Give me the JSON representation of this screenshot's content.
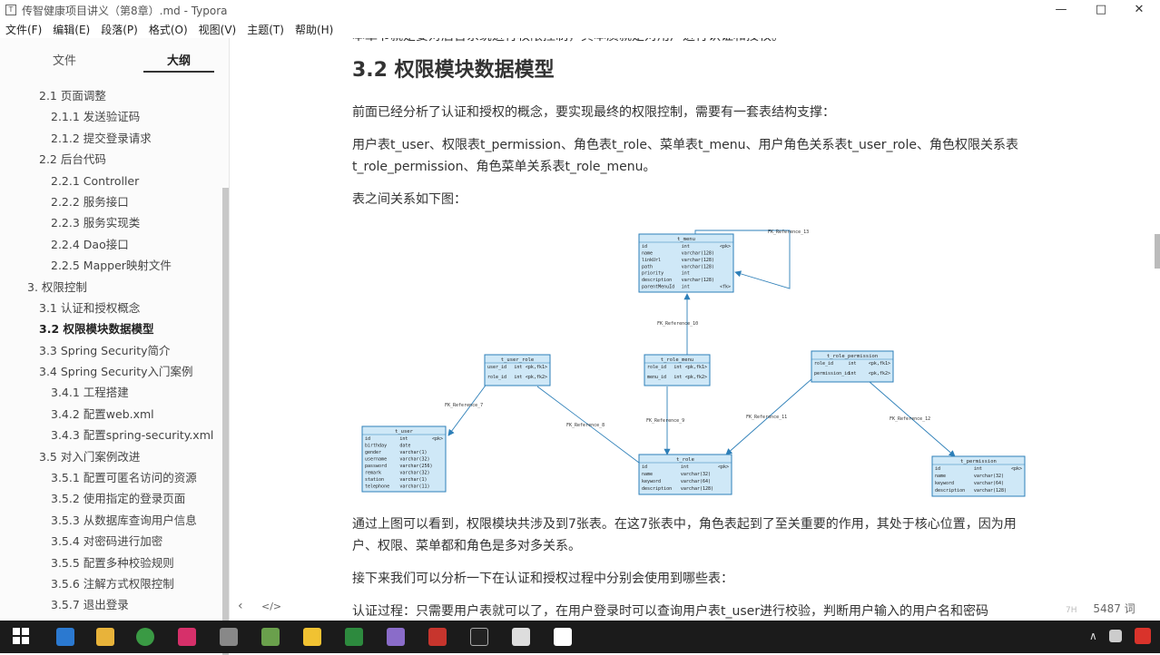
{
  "window": {
    "title": "传智健康项目讲义（第8章）.md - Typora",
    "minimize": "—",
    "maximize": "□",
    "close": "✕"
  },
  "menu": [
    "文件(F)",
    "编辑(E)",
    "段落(P)",
    "格式(O)",
    "视图(V)",
    "主题(T)",
    "帮助(H)"
  ],
  "sidebar": {
    "tabs": [
      "文件",
      "大纲"
    ],
    "outline": [
      {
        "label": "2.1 页面调整",
        "level": 2
      },
      {
        "label": "2.1.1 发送验证码",
        "level": 3
      },
      {
        "label": "2.1.2 提交登录请求",
        "level": 3
      },
      {
        "label": "2.2 后台代码",
        "level": 2
      },
      {
        "label": "2.2.1 Controller",
        "level": 3
      },
      {
        "label": "2.2.2 服务接口",
        "level": 3
      },
      {
        "label": "2.2.3 服务实现类",
        "level": 3
      },
      {
        "label": "2.2.4 Dao接口",
        "level": 3
      },
      {
        "label": "2.2.5 Mapper映射文件",
        "level": 3
      },
      {
        "label": "3. 权限控制",
        "level": 1
      },
      {
        "label": "3.1 认证和授权概念",
        "level": 2
      },
      {
        "label": "3.2 权限模块数据模型",
        "level": 2,
        "current": true
      },
      {
        "label": "3.3 Spring Security简介",
        "level": 2
      },
      {
        "label": "3.4 Spring Security入门案例",
        "level": 2
      },
      {
        "label": "3.4.1 工程搭建",
        "level": 3
      },
      {
        "label": "3.4.2 配置web.xml",
        "level": 3
      },
      {
        "label": "3.4.3 配置spring-security.xml",
        "level": 3
      },
      {
        "label": "3.5 对入门案例改进",
        "level": 2
      },
      {
        "label": "3.5.1 配置可匿名访问的资源",
        "level": 3
      },
      {
        "label": "3.5.2 使用指定的登录页面",
        "level": 3
      },
      {
        "label": "3.5.3 从数据库查询用户信息",
        "level": 3
      },
      {
        "label": "3.5.4 对密码进行加密",
        "level": 3
      },
      {
        "label": "3.5.5 配置多种校验规则",
        "level": 3
      },
      {
        "label": "3.5.6 注解方式权限控制",
        "level": 3
      },
      {
        "label": "3.5.7 退出登录",
        "level": 3
      }
    ],
    "footer_back": "‹",
    "footer_source": "</>"
  },
  "doc": {
    "cut_line": "本章节就是要对后台系统进行权限控制，其本质就是对用户进行认证和授权。",
    "heading": "3.2 权限模块数据模型",
    "p1": "前面已经分析了认证和授权的概念，要实现最终的权限控制，需要有一套表结构支撑：",
    "p2": "用户表t_user、权限表t_permission、角色表t_role、菜单表t_menu、用户角色关系表t_user_role、角色权限关系表t_role_permission、角色菜单关系表t_role_menu。",
    "p3": "表之间关系如下图：",
    "p4": "通过上图可以看到，权限模块共涉及到7张表。在这7张表中，角色表起到了至关重要的作用，其处于核心位置，因为用户、权限、菜单都和角色是多对多关系。",
    "p5": "接下来我们可以分析一下在认证和授权过程中分别会使用到哪些表：",
    "p6": "认证过程：只需要用户表就可以了，在用户登录时可以查询用户表t_user进行校验，判断用户输入的用户名和密码"
  },
  "diagram": {
    "tables": {
      "t_menu": {
        "title": "t_menu",
        "rows": [
          [
            "id",
            "int",
            "<pk>"
          ],
          [
            "name",
            "varchar(128)",
            ""
          ],
          [
            "linkUrl",
            "varchar(128)",
            ""
          ],
          [
            "path",
            "varchar(128)",
            ""
          ],
          [
            "priority",
            "int",
            ""
          ],
          [
            "description",
            "varchar(128)",
            ""
          ],
          [
            "parentMenuId",
            "int",
            "<fk>"
          ]
        ]
      },
      "t_user_role": {
        "title": "t_user_role",
        "rows": [
          [
            "user_id",
            "int",
            "<pk,fk1>"
          ],
          [
            "role_id",
            "int",
            "<pk,fk2>"
          ]
        ]
      },
      "t_role_menu": {
        "title": "t_role_menu",
        "rows": [
          [
            "role_id",
            "int",
            "<pk,fk1>"
          ],
          [
            "menu_id",
            "int",
            "<pk,fk2>"
          ]
        ]
      },
      "t_role_permission": {
        "title": "t_role_permission",
        "rows": [
          [
            "role_id",
            "int",
            "<pk,fk1>"
          ],
          [
            "permission_id",
            "int",
            "<pk,fk2>"
          ]
        ]
      },
      "t_user": {
        "title": "t_user",
        "rows": [
          [
            "id",
            "int",
            "<pk>"
          ],
          [
            "birthday",
            "date",
            ""
          ],
          [
            "gender",
            "varchar(1)",
            ""
          ],
          [
            "username",
            "varchar(32)",
            ""
          ],
          [
            "password",
            "varchar(256)",
            ""
          ],
          [
            "remark",
            "varchar(32)",
            ""
          ],
          [
            "station",
            "varchar(1)",
            ""
          ],
          [
            "telephone",
            "varchar(11)",
            ""
          ]
        ]
      },
      "t_role": {
        "title": "t_role",
        "rows": [
          [
            "id",
            "int",
            "<pk>"
          ],
          [
            "name",
            "varchar(32)",
            ""
          ],
          [
            "keyword",
            "varchar(64)",
            ""
          ],
          [
            "description",
            "varchar(128)",
            ""
          ]
        ]
      },
      "t_permission": {
        "title": "t_permission",
        "rows": [
          [
            "id",
            "int",
            "<pk>"
          ],
          [
            "name",
            "varchar(32)",
            ""
          ],
          [
            "keyword",
            "varchar(64)",
            ""
          ],
          [
            "description",
            "varchar(128)",
            ""
          ]
        ]
      }
    },
    "refs": [
      "FK_Reference_13",
      "FK_Reference_10",
      "FK_Reference_7",
      "FK_Reference_8",
      "FK_Reference_9",
      "FK_Reference_11",
      "FK_Reference_12"
    ]
  },
  "status": {
    "word_count": "5487 词",
    "small": "7H"
  },
  "colors": {
    "table_bg": "#cfe8f7",
    "table_border": "#2d7fb8",
    "taskbar": "#1b1b1b"
  }
}
